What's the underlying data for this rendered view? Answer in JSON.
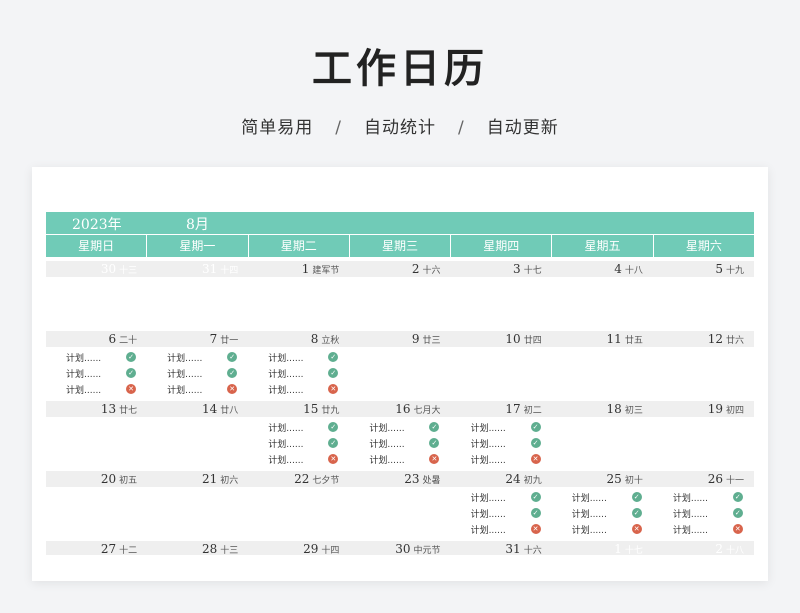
{
  "hero": {
    "title": "工作日历",
    "features": [
      "简单易用",
      "自动统计",
      "自动更新"
    ],
    "separator": "/"
  },
  "calendar": {
    "year_label": "2023年",
    "month_label": "8月",
    "weekdays": [
      "星期日",
      "星期一",
      "星期二",
      "星期三",
      "星期四",
      "星期五",
      "星期六"
    ],
    "task_label": "计划......",
    "colors": {
      "header": "#70cbb7",
      "done": "#5fae90",
      "undone": "#d8644c",
      "day_bar": "#efefef"
    },
    "weeks": [
      {
        "days": [
          {
            "day": "30",
            "lunar": "十三",
            "other": true,
            "tasks": []
          },
          {
            "day": "31",
            "lunar": "十四",
            "other": true,
            "tasks": []
          },
          {
            "day": "1",
            "lunar": "建军节",
            "tasks": []
          },
          {
            "day": "2",
            "lunar": "十六",
            "tasks": []
          },
          {
            "day": "3",
            "lunar": "十七",
            "tasks": []
          },
          {
            "day": "4",
            "lunar": "十八",
            "tasks": []
          },
          {
            "day": "5",
            "lunar": "十九",
            "tasks": []
          }
        ]
      },
      {
        "days": [
          {
            "day": "6",
            "lunar": "二十",
            "tasks": [
              "done",
              "done",
              "undone"
            ]
          },
          {
            "day": "7",
            "lunar": "廿一",
            "tasks": [
              "done",
              "done",
              "undone"
            ]
          },
          {
            "day": "8",
            "lunar": "立秋",
            "tasks": [
              "done",
              "done",
              "undone"
            ]
          },
          {
            "day": "9",
            "lunar": "廿三",
            "tasks": []
          },
          {
            "day": "10",
            "lunar": "廿四",
            "tasks": []
          },
          {
            "day": "11",
            "lunar": "廿五",
            "tasks": []
          },
          {
            "day": "12",
            "lunar": "廿六",
            "tasks": []
          }
        ]
      },
      {
        "days": [
          {
            "day": "13",
            "lunar": "廿七",
            "tasks": []
          },
          {
            "day": "14",
            "lunar": "廿八",
            "tasks": []
          },
          {
            "day": "15",
            "lunar": "廿九",
            "tasks": [
              "done",
              "done",
              "undone"
            ]
          },
          {
            "day": "16",
            "lunar": "七月大",
            "tasks": [
              "done",
              "done",
              "undone"
            ]
          },
          {
            "day": "17",
            "lunar": "初二",
            "tasks": [
              "done",
              "done",
              "undone"
            ]
          },
          {
            "day": "18",
            "lunar": "初三",
            "tasks": []
          },
          {
            "day": "19",
            "lunar": "初四",
            "tasks": []
          }
        ]
      },
      {
        "days": [
          {
            "day": "20",
            "lunar": "初五",
            "tasks": []
          },
          {
            "day": "21",
            "lunar": "初六",
            "tasks": []
          },
          {
            "day": "22",
            "lunar": "七夕节",
            "tasks": []
          },
          {
            "day": "23",
            "lunar": "处暑",
            "tasks": []
          },
          {
            "day": "24",
            "lunar": "初九",
            "tasks": [
              "done",
              "done",
              "undone"
            ]
          },
          {
            "day": "25",
            "lunar": "初十",
            "tasks": [
              "done",
              "done",
              "undone"
            ]
          },
          {
            "day": "26",
            "lunar": "十一",
            "tasks": [
              "done",
              "done",
              "undone"
            ]
          }
        ]
      },
      {
        "days": [
          {
            "day": "27",
            "lunar": "十二",
            "tasks": []
          },
          {
            "day": "28",
            "lunar": "十三",
            "tasks": []
          },
          {
            "day": "29",
            "lunar": "十四",
            "tasks": []
          },
          {
            "day": "30",
            "lunar": "中元节",
            "tasks": []
          },
          {
            "day": "31",
            "lunar": "十六",
            "tasks": []
          },
          {
            "day": "1",
            "lunar": "十七",
            "other": true,
            "tasks": []
          },
          {
            "day": "2",
            "lunar": "十八",
            "other": true,
            "tasks": []
          }
        ]
      }
    ]
  }
}
